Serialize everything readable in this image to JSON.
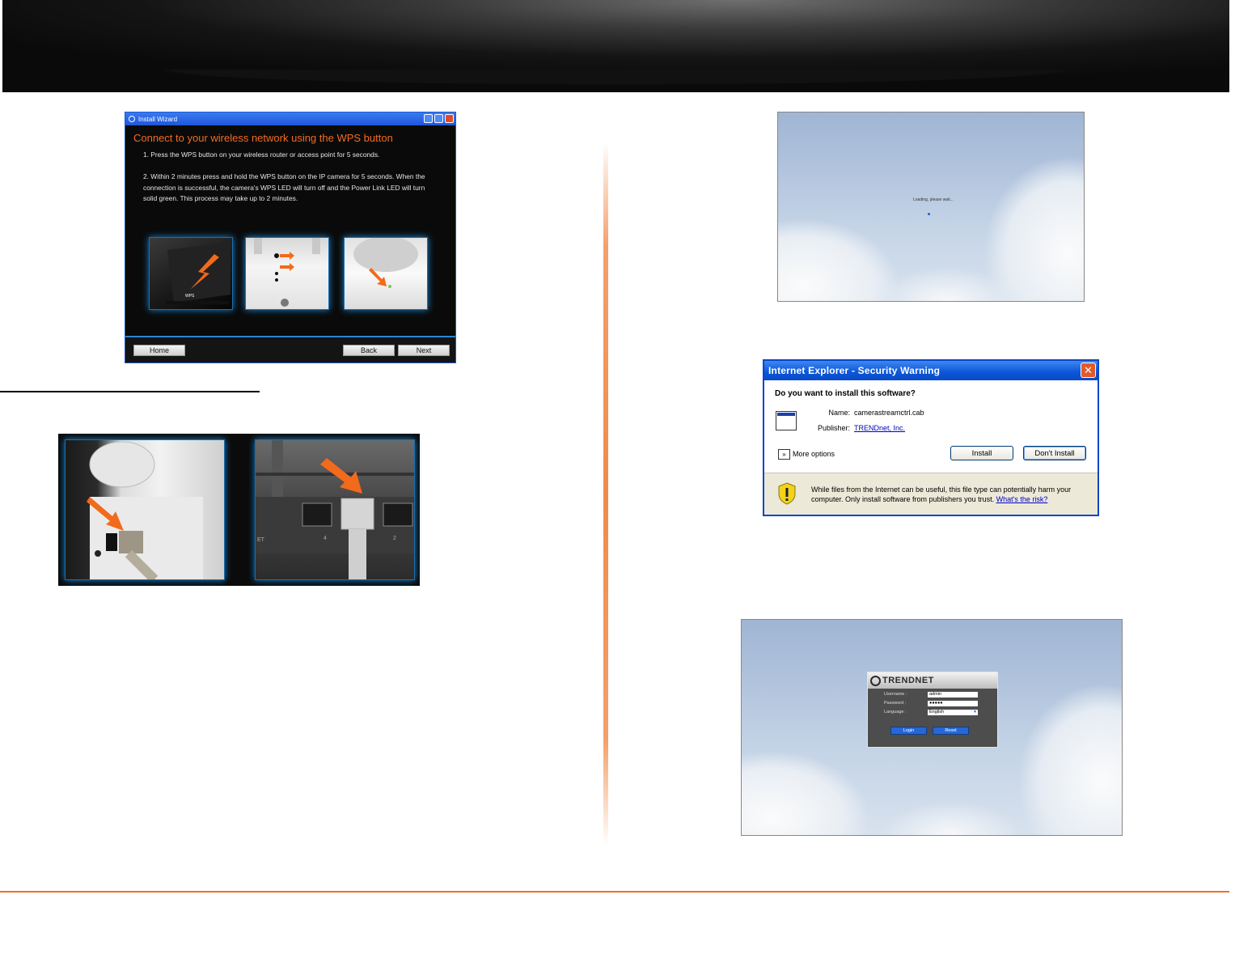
{
  "wizard": {
    "window_title": "Install Wizard",
    "heading": "Connect to your wireless network using the WPS button",
    "step1": "1. Press the WPS button on your wireless router or access point for 5 seconds.",
    "step2": "2. Within 2 minutes press and hold the WPS button on the IP camera for 5 seconds. When the connection is successful, the camera's WPS LED will turn off and the Power Link LED will turn solid green. This process may take up to 2 minutes.",
    "photo_label": "WPS",
    "buttons": {
      "home": "Home",
      "back": "Back",
      "next": "Next"
    }
  },
  "cable_photo": {
    "port_labels": [
      "ET",
      "4",
      "2"
    ]
  },
  "loading": {
    "text": "Loading, please wait..."
  },
  "security_warning": {
    "title": "Internet Explorer - Security Warning",
    "question": "Do you want to install this software?",
    "name_label": "Name:",
    "name_value": "camerastreamctrl.cab",
    "publisher_label": "Publisher:",
    "publisher_value": "TRENDnet, Inc.",
    "more_options": "More options",
    "install_button": "Install",
    "dont_install_button": "Don't Install",
    "warning_text": "While files from the Internet can be useful, this file type can potentially harm your computer. Only install software from publishers you trust.",
    "risk_link": "What's the risk?"
  },
  "login": {
    "brand": "TRENDNET",
    "username_label": "Username :",
    "username_value": "admin",
    "password_label": "Password :",
    "password_value": "●●●●●",
    "language_label": "Language :",
    "language_value": "English",
    "login_button": "Login",
    "reset_button": "Reset"
  },
  "colors": {
    "accent_orange": "#f36b21",
    "xp_blue": "#0a45c9",
    "glow_blue": "#1a82cc"
  }
}
